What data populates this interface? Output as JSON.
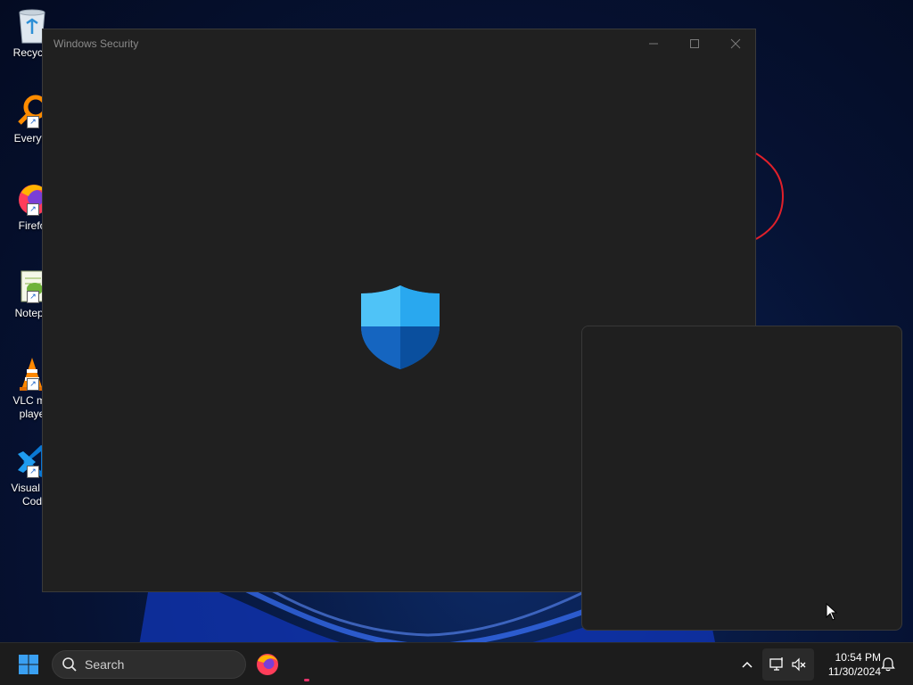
{
  "desktop": {
    "icons": [
      {
        "label": "Recycle",
        "icon": "recycle-bin-icon"
      },
      {
        "label": "Everyth",
        "icon": "everything-search-icon"
      },
      {
        "label": "Firefo",
        "icon": "firefox-icon"
      },
      {
        "label": "Notepa",
        "icon": "notepad-plus-plus-icon"
      },
      {
        "label_line1": "VLC me",
        "label_line2": "playe",
        "icon": "vlc-cone-icon"
      },
      {
        "label_line1": "Visual St",
        "label_line2": "Cod",
        "icon": "vscode-icon"
      }
    ]
  },
  "window": {
    "title": "Windows Security",
    "controls": [
      "minimize",
      "maximize",
      "close"
    ]
  },
  "taskbar": {
    "search_placeholder": "Search",
    "pinned": [
      "firefox-icon"
    ],
    "tray": {
      "time": "10:54 PM",
      "date": "11/30/2024"
    }
  },
  "colors": {
    "window_bg": "#202020",
    "taskbar_bg": "#1c1c1c",
    "shield_light": "#29b6f6",
    "shield_dark": "#0a5cb3",
    "scribble": "#e0202a"
  }
}
